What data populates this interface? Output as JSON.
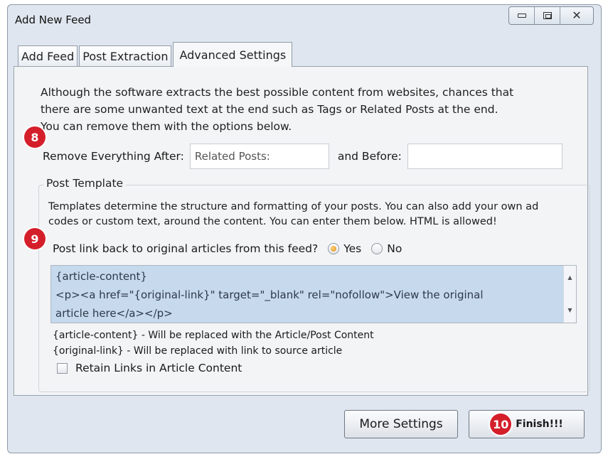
{
  "window": {
    "title": "Add New Feed",
    "controls": {
      "minimize": "minimize-icon",
      "maximize": "maximize-icon",
      "close": "close-icon"
    }
  },
  "tabs": [
    {
      "label": "Add Feed",
      "active": false
    },
    {
      "label": "Post Extraction",
      "active": false
    },
    {
      "label": "Advanced Settings",
      "active": true
    }
  ],
  "advanced": {
    "intro_lines": [
      "Although the software extracts the best possible content from websites, chances that",
      "there are some unwanted text at the end such as Tags or Related Posts at the end.",
      "You can remove them with the options below."
    ],
    "remove_after_label": "Remove Everything After:",
    "remove_after_value": "Related Posts:",
    "before_label": "and Before:",
    "before_value": ""
  },
  "post_template": {
    "legend": "Post Template",
    "description_lines": [
      "Templates determine the structure and formatting of your posts. You can also add your own ad",
      "codes or custom text, around the content. You can enter them below. HTML is allowed!"
    ],
    "link_back_question": "Post link back to original articles from this feed?",
    "option_yes": "Yes",
    "option_no": "No",
    "selected": "Yes",
    "template_lines": [
      "{article-content}",
      "<p><a href=\"{original-link}\" target=\"_blank\" rel=\"nofollow\">View the original",
      "article here</a></p>"
    ],
    "hint_lines": [
      "{article-content} - Will be replaced with the Article/Post Content",
      "{original-link} - Will be replaced with link to source article"
    ],
    "retain_links_label": "Retain Links in Article Content",
    "retain_links_checked": false
  },
  "buttons": {
    "more_settings": "More Settings",
    "finish": "Finish!!!"
  },
  "markers": [
    "8",
    "9",
    "10"
  ],
  "colors": {
    "marker_red": "#d41f2b",
    "template_bg": "#c6d9ed",
    "window_bg": "#dfe6ef"
  }
}
